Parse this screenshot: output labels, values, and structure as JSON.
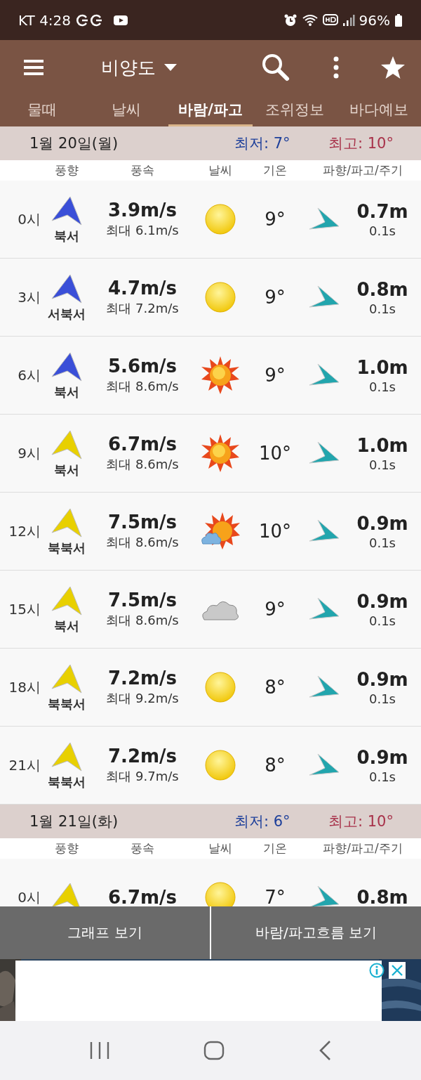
{
  "status_bar": {
    "carrier_time": "KT 4:28",
    "battery": "96%"
  },
  "app_bar": {
    "title": "비양도"
  },
  "tabs": [
    {
      "label": "물때",
      "selected": false
    },
    {
      "label": "날씨",
      "selected": false
    },
    {
      "label": "바람/파고",
      "selected": true
    },
    {
      "label": "조위정보",
      "selected": false
    },
    {
      "label": "바다예보",
      "selected": false
    }
  ],
  "days": [
    {
      "date": "1월 20일(월)",
      "low": "최저: 7°",
      "high": "최고: 10°",
      "columns": [
        "풍향",
        "풍속",
        "날씨",
        "기온",
        "파향/파고/주기"
      ],
      "rows": [
        {
          "time": "0시",
          "wind_dir": "북서",
          "color": "#3a4fd8",
          "speed": "3.9m/s",
          "max": "최대 6.1m/s",
          "kind": "sun",
          "temp": "9°",
          "wave": "0.7m",
          "period": "0.1s"
        },
        {
          "time": "3시",
          "wind_dir": "서북서",
          "color": "#3a4fd8",
          "speed": "4.7m/s",
          "max": "최대 7.2m/s",
          "kind": "sun",
          "temp": "9°",
          "wave": "0.8m",
          "period": "0.1s"
        },
        {
          "time": "6시",
          "wind_dir": "북서",
          "color": "#3a4fd8",
          "speed": "5.6m/s",
          "max": "최대 8.6m/s",
          "kind": "sun-rays",
          "temp": "9°",
          "wave": "1.0m",
          "period": "0.1s"
        },
        {
          "time": "9시",
          "wind_dir": "북서",
          "color": "#e8d000",
          "speed": "6.7m/s",
          "max": "최대 8.6m/s",
          "kind": "sun-rays",
          "temp": "10°",
          "wave": "1.0m",
          "period": "0.1s"
        },
        {
          "time": "12시",
          "wind_dir": "북북서",
          "color": "#e8d000",
          "speed": "7.5m/s",
          "max": "최대 8.6m/s",
          "kind": "sun-cloud",
          "temp": "10°",
          "wave": "0.9m",
          "period": "0.1s"
        },
        {
          "time": "15시",
          "wind_dir": "북서",
          "color": "#e8d000",
          "speed": "7.5m/s",
          "max": "최대 8.6m/s",
          "kind": "cloud",
          "temp": "9°",
          "wave": "0.9m",
          "period": "0.1s"
        },
        {
          "time": "18시",
          "wind_dir": "북북서",
          "color": "#e8d000",
          "speed": "7.2m/s",
          "max": "최대 9.2m/s",
          "kind": "sun",
          "temp": "8°",
          "wave": "0.9m",
          "period": "0.1s"
        },
        {
          "time": "21시",
          "wind_dir": "북북서",
          "color": "#e8d000",
          "speed": "7.2m/s",
          "max": "최대 9.7m/s",
          "kind": "sun",
          "temp": "8°",
          "wave": "0.9m",
          "period": "0.1s"
        }
      ]
    },
    {
      "date": "1월 21일(화)",
      "low": "최저: 6°",
      "high": "최고: 10°",
      "columns": [
        "풍향",
        "풍속",
        "날씨",
        "기온",
        "파향/파고/주기"
      ],
      "rows": [
        {
          "time": "0시",
          "color": "#e8d000",
          "speed": "6.7m/s",
          "kind": "sun",
          "temp": "7°",
          "wave": "0.8m"
        }
      ]
    }
  ],
  "bottom_buttons": [
    "그래프 보기",
    "바람/파고흐름 보기"
  ]
}
